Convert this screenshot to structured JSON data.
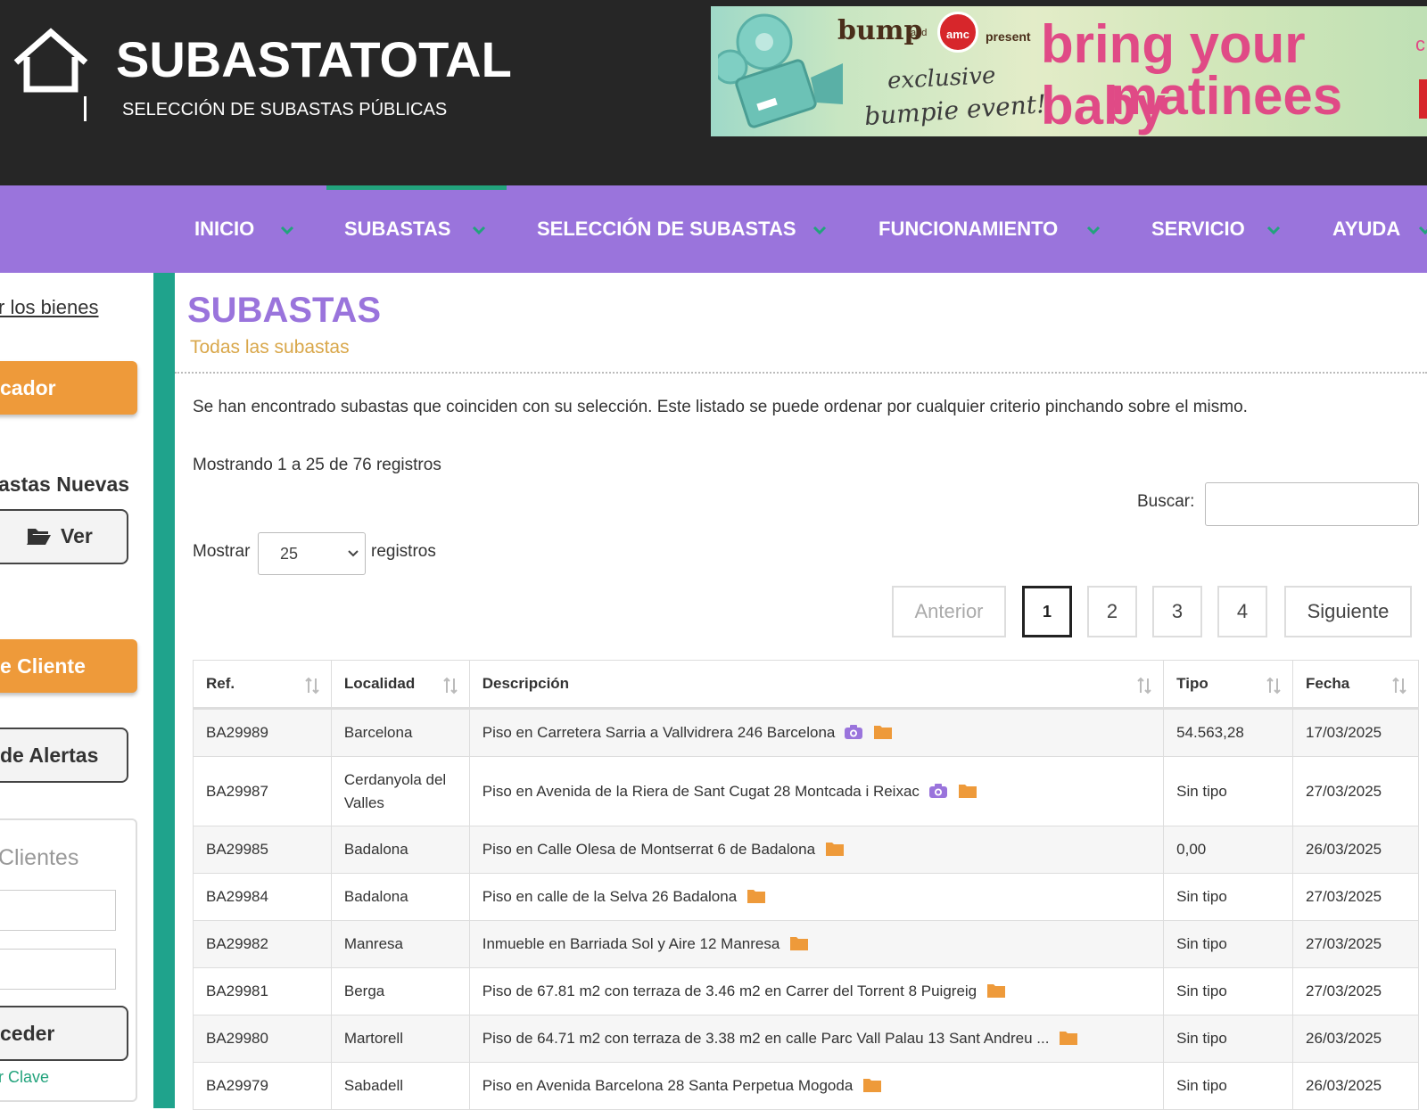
{
  "header": {
    "logo_title": "SUBASTATOTAL",
    "logo_subtitle": "SELECCIÓN DE SUBASTAS PÚBLICAS"
  },
  "banner": {
    "brand": "bump",
    "and": "and",
    "amc": "amc",
    "present": "present",
    "line1": "exclusive",
    "line2": "bumpie event!",
    "big1": "bring your baby",
    "big2": "matinees",
    "edge": "c"
  },
  "nav": {
    "items": [
      {
        "label": "INICIO"
      },
      {
        "label": "SUBASTAS"
      },
      {
        "label": "SELECCIÓN DE SUBASTAS"
      },
      {
        "label": "FUNCIONAMIENTO"
      },
      {
        "label": "SERVICIO"
      },
      {
        "label": "AYUDA"
      }
    ],
    "active_color": "#22a37c",
    "bg_color": "#9a74dc"
  },
  "sidebar": {
    "link": "r los bienes",
    "buscador_btn": "cador",
    "nuevas_heading": "astas Nuevas",
    "ver_btn": "Ver",
    "cliente_btn": "e Cliente",
    "alertas_btn": "de Alertas",
    "clientes_title": "Clientes",
    "acceder_btn": "ceder",
    "clave_link": "r Clave"
  },
  "main": {
    "title": "SUBASTAS",
    "subtitle": "Todas las subastas",
    "intro": "Se han encontrado subastas que coinciden con su selección. Este listado se puede ordenar por cualquier criterio pinchando sobre el mismo.",
    "showing": "Mostrando 1 a 25 de 76 registros",
    "search_label": "Buscar:",
    "search_value": "",
    "length_label_before": "Mostrar",
    "length_value": "25",
    "length_label_after": "registros"
  },
  "pagination": {
    "prev": "Anterior",
    "pages": [
      "1",
      "2",
      "3",
      "4"
    ],
    "current": "1",
    "next": "Siguiente"
  },
  "table": {
    "columns": [
      "Ref.",
      "Localidad",
      "Descripción",
      "Tipo",
      "Fecha"
    ],
    "rows": [
      {
        "ref": "BA29989",
        "localidad": "Barcelona",
        "descripcion": "Piso en Carretera Sarria a Vallvidrera 246 Barcelona",
        "photo": true,
        "tipo": "54.563,28",
        "fecha": "17/03/2025"
      },
      {
        "ref": "BA29987",
        "localidad": "Cerdanyola del Valles",
        "descripcion": "Piso en Avenida de la Riera de Sant Cugat 28 Montcada i Reixac",
        "photo": true,
        "tipo": "Sin tipo",
        "fecha": "27/03/2025"
      },
      {
        "ref": "BA29985",
        "localidad": "Badalona",
        "descripcion": "Piso en Calle Olesa de Montserrat 6 de Badalona",
        "photo": false,
        "tipo": "0,00",
        "fecha": "26/03/2025"
      },
      {
        "ref": "BA29984",
        "localidad": "Badalona",
        "descripcion": "Piso en calle de la Selva 26 Badalona",
        "photo": false,
        "tipo": "Sin tipo",
        "fecha": "27/03/2025"
      },
      {
        "ref": "BA29982",
        "localidad": "Manresa",
        "descripcion": "Inmueble en Barriada Sol y Aire 12 Manresa",
        "photo": false,
        "tipo": "Sin tipo",
        "fecha": "27/03/2025"
      },
      {
        "ref": "BA29981",
        "localidad": "Berga",
        "descripcion": "Piso de 67.81 m2 con terraza de 3.46 m2 en Carrer del Torrent 8 Puigreig",
        "photo": false,
        "tipo": "Sin tipo",
        "fecha": "27/03/2025"
      },
      {
        "ref": "BA29980",
        "localidad": "Martorell",
        "descripcion": "Piso de 64.71 m2 con terraza de 3.38 m2 en calle Parc Vall Palau 13 Sant Andreu ...",
        "photo": false,
        "tipo": "Sin tipo",
        "fecha": "26/03/2025"
      },
      {
        "ref": "BA29979",
        "localidad": "Sabadell",
        "descripcion": "Piso en Avenida Barcelona 28 Santa Perpetua Mogoda",
        "photo": false,
        "tipo": "Sin tipo",
        "fecha": "26/03/2025"
      }
    ]
  },
  "icons": {
    "camera": "camera-icon",
    "folder": "folder-icon",
    "sort": "sort-icon",
    "chevron": "chevron-down-icon",
    "house": "house-icon",
    "folder_open": "folder-open-icon"
  },
  "colors": {
    "header_bg": "#262626",
    "accent_purple": "#9a74dc",
    "accent_orange": "#ee9a3a",
    "accent_teal": "#1fa38c",
    "subtitle_gold": "#d9a74a",
    "camera_purple": "#9a74dc",
    "folder_orange": "#ee9a3a"
  }
}
